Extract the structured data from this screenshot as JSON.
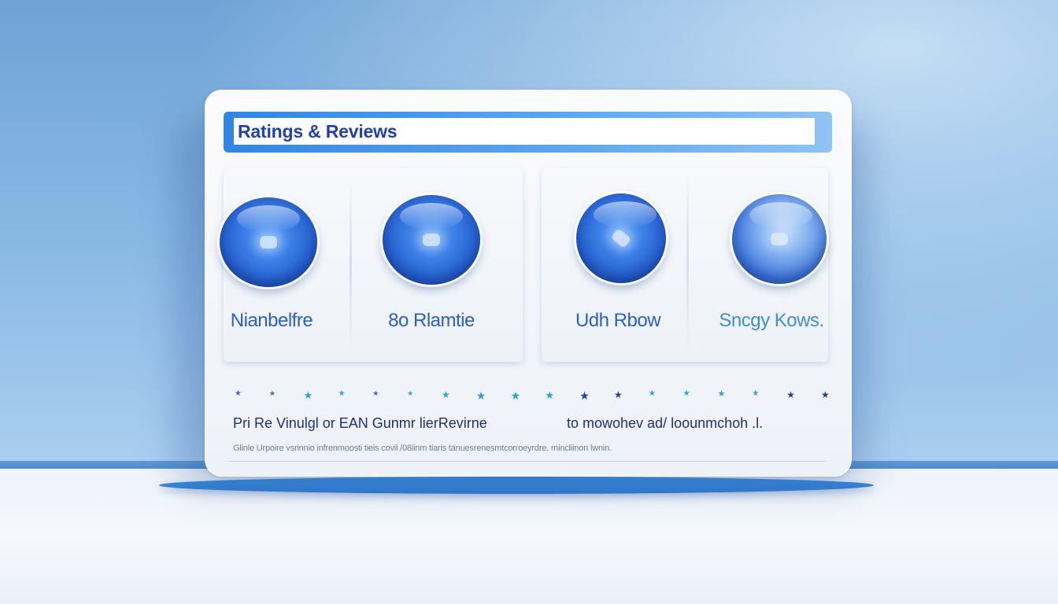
{
  "card": {
    "title": "Ratings & Reviews"
  },
  "options": [
    {
      "label": "Nianbelfre",
      "icon": "chat-bubble-icon"
    },
    {
      "label": "8o Rlamtie",
      "icon": "chat-bubble-icon"
    },
    {
      "label": "Udh Rbow",
      "icon": "glyph-icon"
    },
    {
      "label": "Sncgy Kows.",
      "icon": "glyph-icon"
    }
  ],
  "stars": {
    "count": 18,
    "colors": [
      "#2e6fd6",
      "#2aa0e6",
      "#1f3fa8"
    ]
  },
  "summary": {
    "left": "Pri Re Vinulgl or EAN Gunmr lierRevirne",
    "right": "to mowohev ad/ loounmchoh .l.",
    "fine_print": "Glinle Urpoire vsrinnio infrenmoosti tieis covil /08iinm tiaris tanuesrenesmtcorroeyrdre. rnincliinon lwnin."
  },
  "colors": {
    "accent": "#2f86e6",
    "title_text": "#1f3fb5",
    "label_text": "#2a5fd0"
  }
}
